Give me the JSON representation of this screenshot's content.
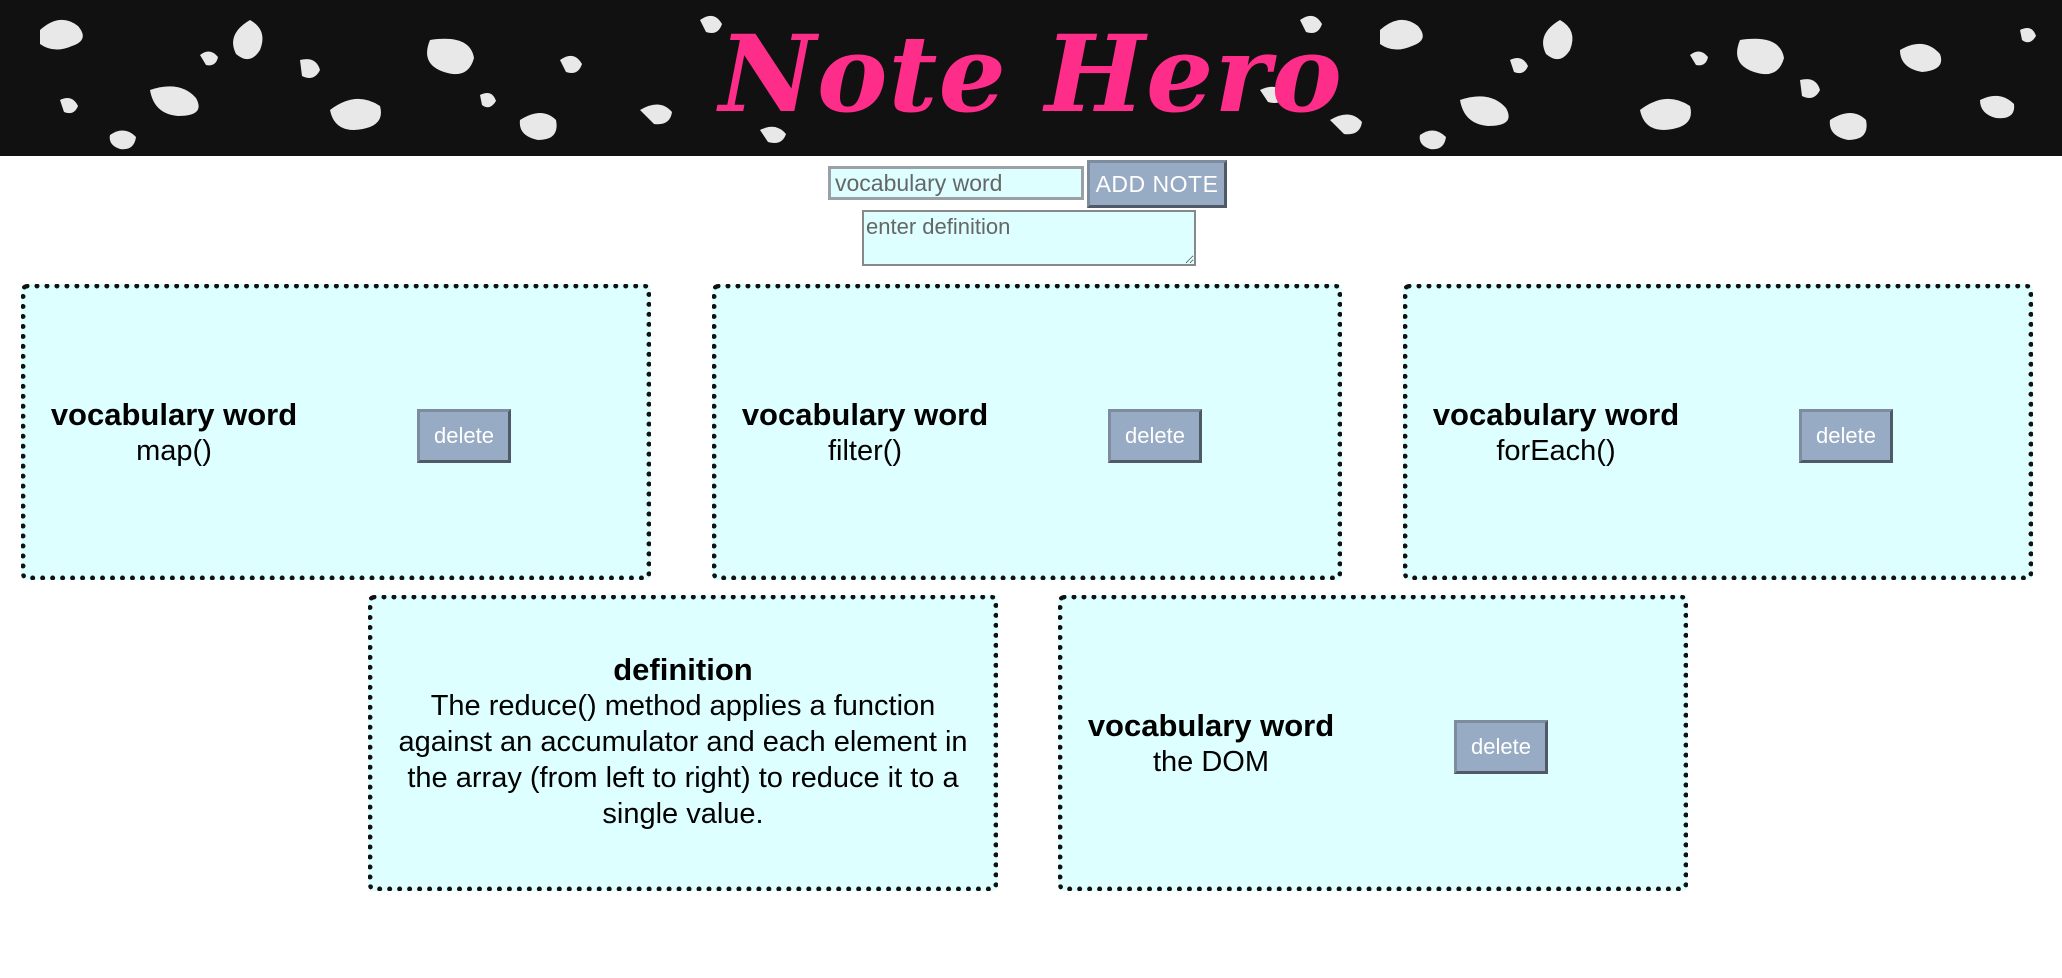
{
  "header": {
    "title": "Note Hero",
    "title_color": "#ff2d8a",
    "background": "black-white-marble-pattern"
  },
  "form": {
    "word_placeholder": "vocabulary word",
    "word_value": "",
    "add_label": "ADD NOTE",
    "definition_placeholder": "enter definition",
    "definition_value": ""
  },
  "colors": {
    "card_background": "#ddffff",
    "card_border": "#111111",
    "button_background": "#97abc4"
  },
  "notes": [
    {
      "side": "word",
      "heading": "vocabulary word",
      "text": "map()",
      "delete_label": "delete"
    },
    {
      "side": "word",
      "heading": "vocabulary word",
      "text": "filter()",
      "delete_label": "delete"
    },
    {
      "side": "word",
      "heading": "vocabulary word",
      "text": "forEach()",
      "delete_label": "delete"
    },
    {
      "side": "definition",
      "heading": "definition",
      "text": "The reduce() method applies a function against an accumulator and each element in the array (from left to right) to reduce it to a single value."
    },
    {
      "side": "word",
      "heading": "vocabulary word",
      "text": "the DOM",
      "delete_label": "delete"
    }
  ]
}
